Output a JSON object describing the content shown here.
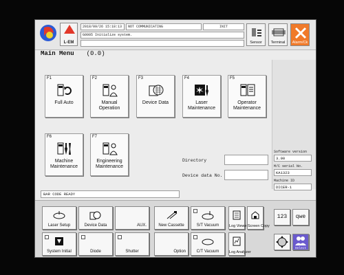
{
  "header": {
    "logo_label": "L-EM",
    "datetime": "2018/09/26 15:18:13",
    "comm_status": "NOT COMMUNICATING",
    "mode": "INIT",
    "message": "G0005  Initialize system.",
    "sensor_label": "Sensor",
    "terminal_label": "Terminal",
    "alarm_label": "Alarm/Ck"
  },
  "page": {
    "title": "Main Menu",
    "code": "(0.0)"
  },
  "menu": [
    {
      "fkey": "F1",
      "label": "Full Auto",
      "icon": "full-auto-icon"
    },
    {
      "fkey": "F2",
      "label": "Manual Operation",
      "icon": "manual-operation-icon"
    },
    {
      "fkey": "F3",
      "label": "Device Data",
      "icon": "device-data-icon"
    },
    {
      "fkey": "F4",
      "label": "Laser Maintenance",
      "icon": "laser-maintenance-icon"
    },
    {
      "fkey": "F5",
      "label": "Operator Maintenance",
      "icon": "operator-maintenance-icon"
    },
    {
      "fkey": "F6",
      "label": "Machine Maintenance",
      "icon": "machine-maintenance-icon"
    },
    {
      "fkey": "F7",
      "label": "Engineering Maintenance",
      "icon": "engineering-maintenance-icon"
    }
  ],
  "fields": {
    "directory_label": "Directory",
    "directory_value": "",
    "device_data_label": "Device data No.",
    "device_data_value": ""
  },
  "info": {
    "software_version_label": "Software version",
    "software_version": "3.00",
    "serial_label": "M/C serial No.",
    "serial": "KA1323",
    "machine_id_label": "Machine ID",
    "machine_id": "DICER-1"
  },
  "status_bar": "BAR CODE READY",
  "bottom": {
    "laser_setup": "Laser Setup",
    "device_data": "Device Data",
    "aux": "AUX.",
    "new_cassette": "New Cassette",
    "st_vacuum": "S/T Vacuum",
    "log_viewer": "Log Viewer",
    "screen_copy": "Screen Copy",
    "system_initial": "System Initial",
    "diode": "Diode",
    "shutter": "Shutter",
    "option": "Option",
    "ct_vacuum": "C/T Vacuum",
    "log_analyzer": "Log Analyzer",
    "key_123": "123",
    "key_qwe": "qwe",
    "select": "Select"
  },
  "colors": {
    "alarm": "#f07a2a",
    "lem_triangle": "#e2382a",
    "select": "#6a5acd"
  }
}
